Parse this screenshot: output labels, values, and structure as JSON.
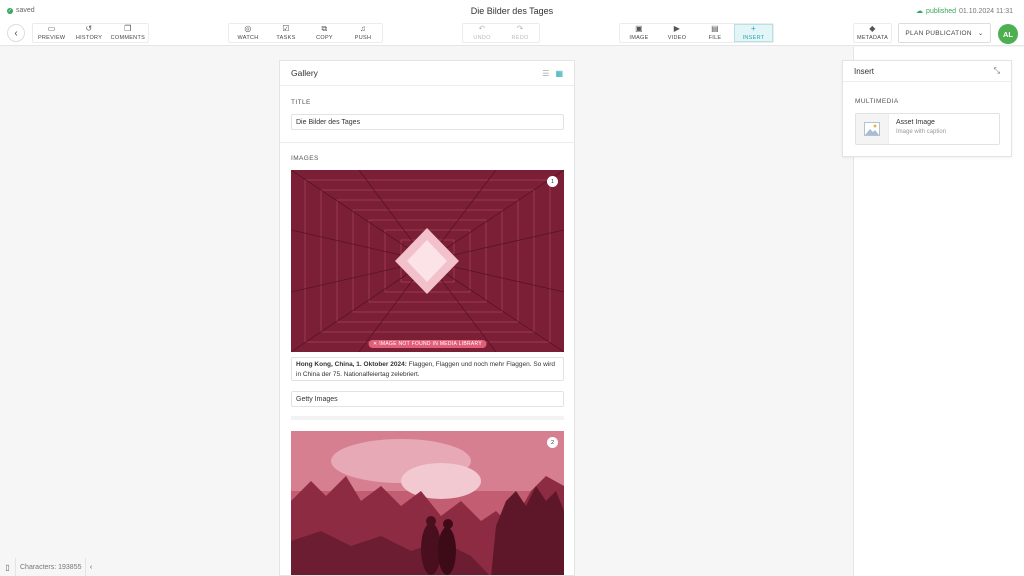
{
  "status": {
    "saved": "saved",
    "published_label": "published",
    "published_date": "01.10.2024 11:31"
  },
  "doc_title": "Die Bilder des Tages",
  "toolbar": {
    "back_icon": "chevron-left-icon",
    "group1": [
      {
        "label": "PREVIEW",
        "icon": "preview-icon"
      },
      {
        "label": "HISTORY",
        "icon": "history-icon"
      },
      {
        "label": "COMMENTS",
        "icon": "comments-icon"
      }
    ],
    "group2": [
      {
        "label": "WATCH",
        "icon": "eye-off-icon"
      },
      {
        "label": "TASKS",
        "icon": "tasks-icon"
      },
      {
        "label": "COPY",
        "icon": "copy-icon"
      },
      {
        "label": "PUSH",
        "icon": "bell-icon"
      }
    ],
    "group3": [
      {
        "label": "UNDO",
        "icon": "undo-icon"
      },
      {
        "label": "REDO",
        "icon": "redo-icon"
      }
    ],
    "group4": [
      {
        "label": "IMAGE",
        "icon": "image-icon"
      },
      {
        "label": "VIDEO",
        "icon": "video-icon"
      },
      {
        "label": "FILE",
        "icon": "file-icon"
      },
      {
        "label": "INSERT",
        "icon": "plus-icon"
      }
    ],
    "metadata": {
      "label": "METADATA",
      "icon": "tag-icon"
    },
    "plan_publication": "PLAN PUBLICATION",
    "avatar": "AL"
  },
  "gallery": {
    "title": "Gallery",
    "title_label": "TITLE",
    "title_value": "Die Bilder des Tages",
    "images_label": "IMAGES",
    "images": [
      {
        "number": "1",
        "error": "IMAGE NOT FOUND IN MEDIA LIBRARY",
        "caption_bold": "Hong Kong, China, 1. Oktober 2024:",
        "caption_text": " Flaggen, Flaggen und noch mehr Flaggen. So wird in China der 75. Nationalfeiertag zelebriert.",
        "credit": "Getty Images"
      },
      {
        "number": "2"
      }
    ]
  },
  "insert_panel": {
    "title": "Insert",
    "section": "MULTIMEDIA",
    "item_name": "Asset Image",
    "item_sub": "Image with caption"
  },
  "footer": {
    "characters": "Characters: 193855"
  },
  "colors": {
    "accent": "#2aa6b3",
    "green": "#37a55c",
    "avatar": "#4caf50",
    "error": "#e0607a"
  }
}
